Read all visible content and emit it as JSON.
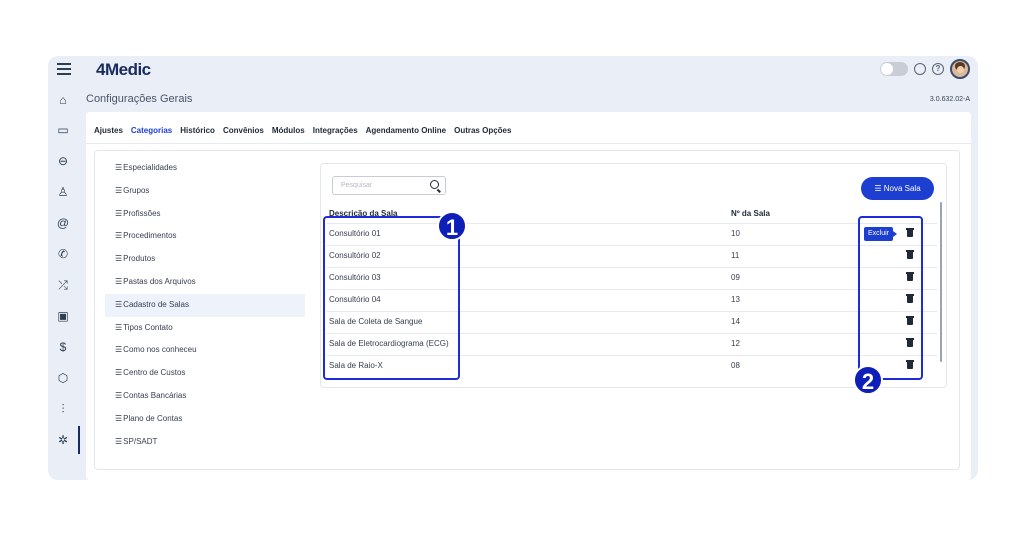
{
  "brand": {
    "logo": "4Medic"
  },
  "header": {
    "title": "Configurações Gerais",
    "version": "3.0.632.02-A"
  },
  "sidebar": {
    "icons": [
      "menu-icon",
      "home-icon",
      "calendar-icon",
      "car-icon",
      "user-icon",
      "at-icon",
      "phone-icon",
      "shuffle-icon",
      "clipboard-icon",
      "dollar-icon",
      "box-icon",
      "chart-icon",
      "gear-icon"
    ]
  },
  "tabs": [
    {
      "label": "Ajustes"
    },
    {
      "label": "Categorias"
    },
    {
      "label": "Histórico"
    },
    {
      "label": "Convênios"
    },
    {
      "label": "Módulos"
    },
    {
      "label": "Integrações"
    },
    {
      "label": "Agendamento Online"
    },
    {
      "label": "Outras Opções"
    }
  ],
  "categories": [
    {
      "label": "Especialidades"
    },
    {
      "label": "Grupos"
    },
    {
      "label": "Profissões"
    },
    {
      "label": "Procedimentos"
    },
    {
      "label": "Produtos"
    },
    {
      "label": "Pastas dos Arquivos"
    },
    {
      "label": "Cadastro de Salas"
    },
    {
      "label": "Tipos Contato"
    },
    {
      "label": "Como nos conheceu"
    },
    {
      "label": "Centro de Custos"
    },
    {
      "label": "Contas Bancárias"
    },
    {
      "label": "Plano de Contas"
    },
    {
      "label": "SP/SADT"
    }
  ],
  "search": {
    "placeholder": "Pesquisar"
  },
  "new_button": {
    "label": "Nova Sala"
  },
  "table": {
    "headers": [
      "Descrição da Sala",
      "Nº da Sala"
    ],
    "rows": [
      {
        "name": "Consultório 01",
        "number": "10"
      },
      {
        "name": "Consultório 02",
        "number": "11"
      },
      {
        "name": "Consultório 03",
        "number": "09"
      },
      {
        "name": "Consultório 04",
        "number": "13"
      },
      {
        "name": "Sala de Coleta de Sangue",
        "number": "14"
      },
      {
        "name": "Sala de Eletrocardiograma (ECG)",
        "number": "12"
      },
      {
        "name": "Sala de Raio-X",
        "number": "08"
      }
    ]
  },
  "tooltip": {
    "label": "Excluir"
  },
  "markers": [
    "1",
    "2"
  ],
  "colors": {
    "accent": "#1d3fd1",
    "highlight": "#1d2bd8",
    "brand": "#1a2b5f"
  }
}
